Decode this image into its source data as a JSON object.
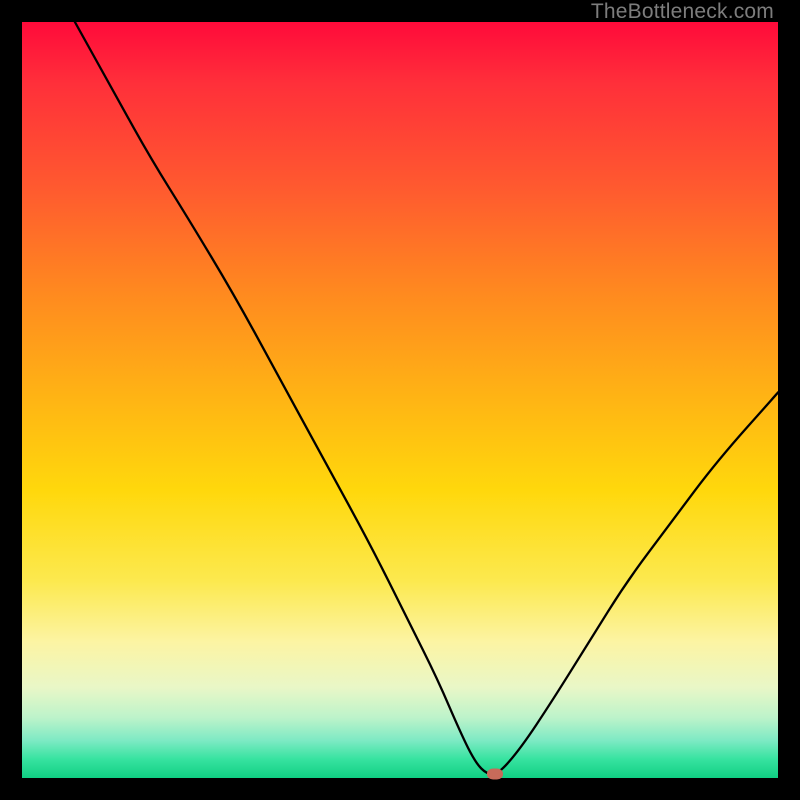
{
  "watermark_text": "TheBottleneck.com",
  "chart_data": {
    "type": "line",
    "title": "",
    "xlabel": "",
    "ylabel": "",
    "xlim": [
      0,
      100
    ],
    "ylim": [
      0,
      100
    ],
    "grid": false,
    "series": [
      {
        "name": "bottleneck-curve",
        "x": [
          7,
          12,
          17,
          22,
          28,
          34,
          40,
          46,
          51,
          55,
          58,
          60,
          61.5,
          63,
          66,
          70,
          75,
          80,
          86,
          92,
          100
        ],
        "values": [
          100,
          91,
          82,
          74,
          64,
          53,
          42,
          31,
          21,
          13,
          6,
          2,
          0.5,
          0.5,
          4,
          10,
          18,
          26,
          34,
          42,
          51
        ]
      }
    ],
    "annotations": [
      {
        "name": "minimum-point",
        "x": 62.5,
        "y": 0.5
      }
    ],
    "colors": {
      "curve": "#000000",
      "marker": "#c76b5a",
      "gradient_top": "#ff0a3a",
      "gradient_bottom": "#10cf83"
    }
  }
}
